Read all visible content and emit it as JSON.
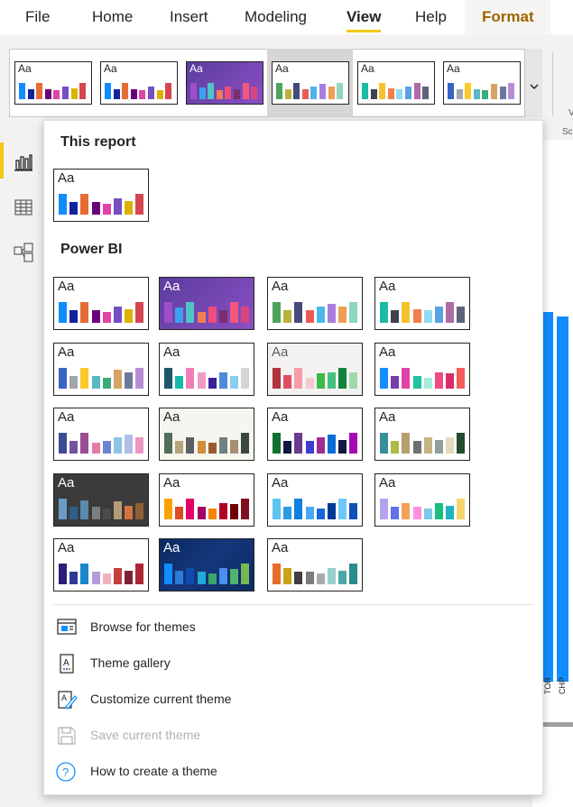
{
  "menu": {
    "file": "File",
    "home": "Home",
    "insert": "Insert",
    "modeling": "Modeling",
    "view": "View",
    "help": "Help",
    "format": "Format"
  },
  "ribbon_partial": {
    "v": "V",
    "sc": "Sc"
  },
  "theme_sample_text": "Aa",
  "dropdown": {
    "section_this_report": "This report",
    "section_power_bi": "Power BI",
    "actions": [
      {
        "label": "Browse for themes",
        "icon": "browse-themes-icon",
        "enabled": true
      },
      {
        "label": "Theme gallery",
        "icon": "theme-gallery-icon",
        "enabled": true
      },
      {
        "label": "Customize current theme",
        "icon": "customize-theme-icon",
        "enabled": true
      },
      {
        "label": "Save current theme",
        "icon": "save-theme-icon",
        "enabled": false
      },
      {
        "label": "How to create a theme",
        "icon": "help-icon",
        "enabled": true
      }
    ]
  },
  "canvas_axis_labels": [
    "TOR",
    "CHP"
  ],
  "colors": {
    "accent_yellow": "#f2c811",
    "format_tab_text": "#9c6500",
    "primary_blue": "#118dff"
  }
}
